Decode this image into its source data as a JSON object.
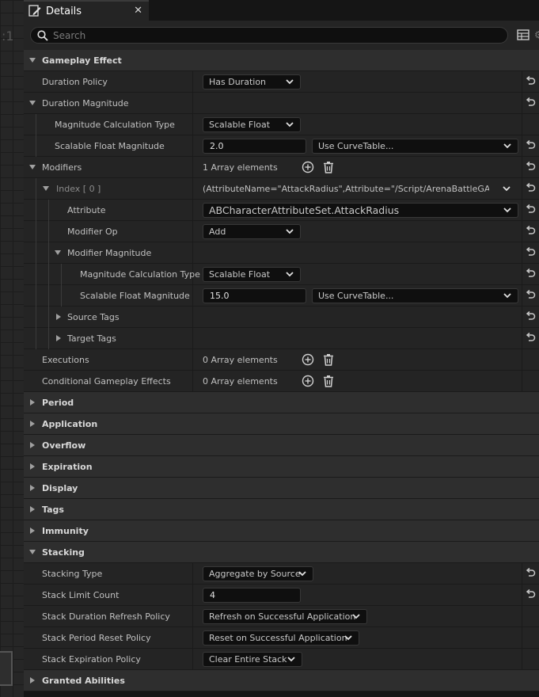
{
  "graph": {
    "glyph": ":1"
  },
  "tab": {
    "title": "Details"
  },
  "search": {
    "placeholder": "Search"
  },
  "rows": {
    "gameplay_effect": "Gameplay Effect",
    "duration_policy": {
      "label": "Duration Policy",
      "value": "Has Duration"
    },
    "duration_magnitude": "Duration Magnitude",
    "dm_calc_type": {
      "label": "Magnitude Calculation Type",
      "value": "Scalable Float"
    },
    "dm_scalable": {
      "label": "Scalable Float Magnitude",
      "value": "2.0",
      "curve": "Use CurveTable..."
    },
    "modifiers": {
      "label": "Modifiers",
      "value": "1 Array elements"
    },
    "index0": {
      "label": "Index [ 0 ]",
      "value": "(AttributeName=\"AttackRadius\",Attribute=\"/Script/ArenaBattleGAS.ABCharacterAttributeSet"
    },
    "attribute": {
      "label": "Attribute",
      "value": "ABCharacterAttributeSet.AttackRadius"
    },
    "modifier_op": {
      "label": "Modifier Op",
      "value": "Add"
    },
    "modifier_magnitude": "Modifier Magnitude",
    "mm_calc_type": {
      "label": "Magnitude Calculation Type",
      "value": "Scalable Float"
    },
    "mm_scalable": {
      "label": "Scalable Float Magnitude",
      "value": "15.0",
      "curve": "Use CurveTable..."
    },
    "source_tags": "Source Tags",
    "target_tags": "Target Tags",
    "executions": {
      "label": "Executions",
      "value": "0 Array elements"
    },
    "conditional": {
      "label": "Conditional Gameplay Effects",
      "value": "0 Array elements"
    },
    "period": "Period",
    "application": "Application",
    "overflow": "Overflow",
    "expiration": "Expiration",
    "display": "Display",
    "tags": "Tags",
    "immunity": "Immunity",
    "stacking": "Stacking",
    "stacking_type": {
      "label": "Stacking Type",
      "value": "Aggregate by Source"
    },
    "stack_limit": {
      "label": "Stack Limit Count",
      "value": "4"
    },
    "stack_duration": {
      "label": "Stack Duration Refresh Policy",
      "value": "Refresh on Successful Application"
    },
    "stack_period": {
      "label": "Stack Period Reset Policy",
      "value": "Reset on Successful Application"
    },
    "stack_expiration": {
      "label": "Stack Expiration Policy",
      "value": "Clear Entire Stack"
    },
    "granted_abilities": "Granted Abilities"
  },
  "icons": {
    "tab": "pencil-icon",
    "close": "close-icon",
    "search": "search-icon",
    "grid": "table-view-icon",
    "reset": "reset-to-default-icon",
    "add": "add-element-icon",
    "delete": "delete-all-icon",
    "expand": "chevron-down-icon"
  },
  "colors": {
    "panel": "#242424",
    "category": "#2e2e2e",
    "field": "#0f0f0f",
    "text": "#c0c0c0"
  }
}
